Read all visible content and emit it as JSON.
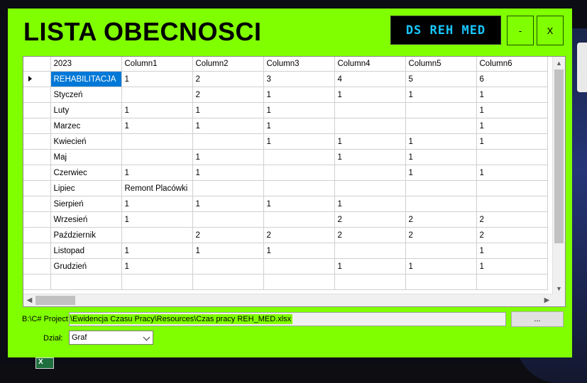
{
  "window": {
    "title": "LISTA OBECNOSCI",
    "brand": "DS REH MED",
    "minimize_label": "-",
    "close_label": "X"
  },
  "grid": {
    "columns": [
      "2023",
      "Column1",
      "Column2",
      "Column3",
      "Column4",
      "Column5",
      "Column6"
    ],
    "rows": [
      [
        "REHABILITACJA",
        "1",
        "2",
        "3",
        "4",
        "5",
        "6"
      ],
      [
        "Styczeń",
        "",
        "2",
        "1",
        "1",
        "1",
        "1"
      ],
      [
        "Luty",
        "1",
        "1",
        "1",
        "",
        "",
        "1"
      ],
      [
        "Marzec",
        "1",
        "1",
        "1",
        "",
        "",
        "1"
      ],
      [
        "Kwiecień",
        "",
        "",
        "1",
        "1",
        "1",
        "1"
      ],
      [
        "Maj",
        "",
        "1",
        "",
        "1",
        "1",
        ""
      ],
      [
        "Czerwiec",
        "1",
        "1",
        "",
        "",
        "1",
        "1"
      ],
      [
        "Lipiec",
        "Remont Placówki",
        "",
        "",
        "",
        "",
        ""
      ],
      [
        "Sierpień",
        "1",
        "1",
        "1",
        "1",
        "",
        ""
      ],
      [
        "Wrzesień",
        "1",
        "",
        "",
        "2",
        "2",
        "2"
      ],
      [
        "Październik",
        "",
        "2",
        "2",
        "2",
        "2",
        "2"
      ],
      [
        "Listopad",
        "1",
        "1",
        "1",
        "",
        "",
        "1"
      ],
      [
        "Grudzień",
        "1",
        "",
        "",
        "1",
        "1",
        "1"
      ],
      [
        "",
        "",
        "",
        "",
        "",
        "",
        ""
      ]
    ],
    "current_row_index": 0,
    "selected_cell": "REHABILITACJA"
  },
  "path": {
    "label": "B:\\C# Project",
    "value": "\\Ewidencja Czasu Pracy\\Resources\\Czas pracy REH_MED.xlsx",
    "browse_label": "..."
  },
  "dzial": {
    "label": "Dział:",
    "value": "Graf"
  },
  "colors": {
    "form_background": "#80ff00",
    "brand_background": "#000000",
    "brand_text": "#19c7ff",
    "selection": "#0078d7"
  },
  "icons": {
    "taskbar": "excel-icon",
    "current_row": "row-pointer-icon",
    "dropdown": "chevron-down-icon"
  }
}
